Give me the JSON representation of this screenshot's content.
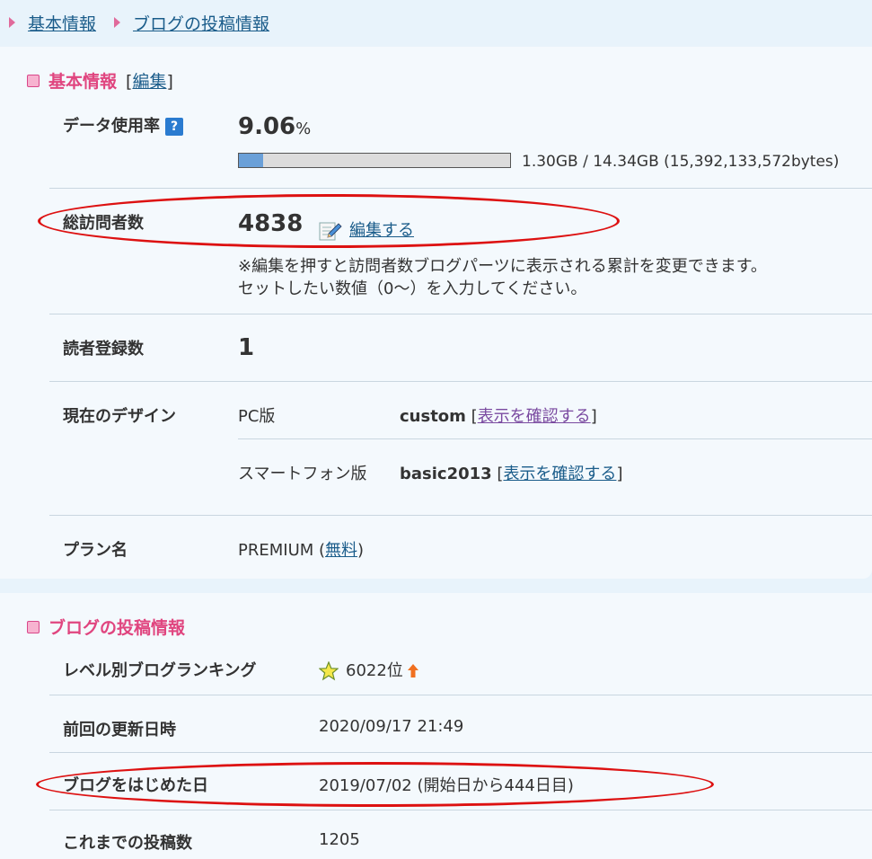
{
  "breadcrumb": {
    "items": [
      "基本情報",
      "ブログの投稿情報"
    ]
  },
  "basic_info": {
    "title": "基本情報",
    "edit_link": "編集",
    "data_usage": {
      "label": "データ使用率",
      "help_icon": "?",
      "percent_value": "9.06",
      "percent_unit": "%",
      "usage_fraction": 0.0906,
      "detail": "1.30GB / 14.34GB (15,392,133,572bytes)"
    },
    "visitors": {
      "label": "総訪問者数",
      "value": "4838",
      "edit_label": "編集する",
      "note_line1": "※編集を押すと訪問者数ブログパーツに表示される累計を変更できます。",
      "note_line2": "セットしたい数値（0〜）を入力してください。"
    },
    "subscribers": {
      "label": "読者登録数",
      "value": "1"
    },
    "design": {
      "label": "現在のデザイン",
      "pc_label": "PC版",
      "pc_value": "custom",
      "pc_link": "表示を確認する",
      "sp_label": "スマートフォン版",
      "sp_value": "basic2013",
      "sp_link": "表示を確認する"
    },
    "plan": {
      "label": "プラン名",
      "value": "PREMIUM",
      "link": "無料"
    }
  },
  "post_info": {
    "title": "ブログの投稿情報",
    "ranking": {
      "label": "レベル別ブログランキング",
      "value": "6022位"
    },
    "last_update": {
      "label": "前回の更新日時",
      "value": "2020/09/17 21:49"
    },
    "start_date": {
      "label": "ブログをはじめた日",
      "value": "2019/07/02 (開始日から444日目)"
    },
    "post_count": {
      "label": "これまでの投稿数",
      "value": "1205"
    }
  },
  "colors": {
    "accent_pink": "#e0457f",
    "link_blue": "#1a5c8a",
    "highlight_red": "#dd1111"
  },
  "icons": [
    "help-icon",
    "edit-icon",
    "star-icon",
    "up-arrow-icon"
  ]
}
